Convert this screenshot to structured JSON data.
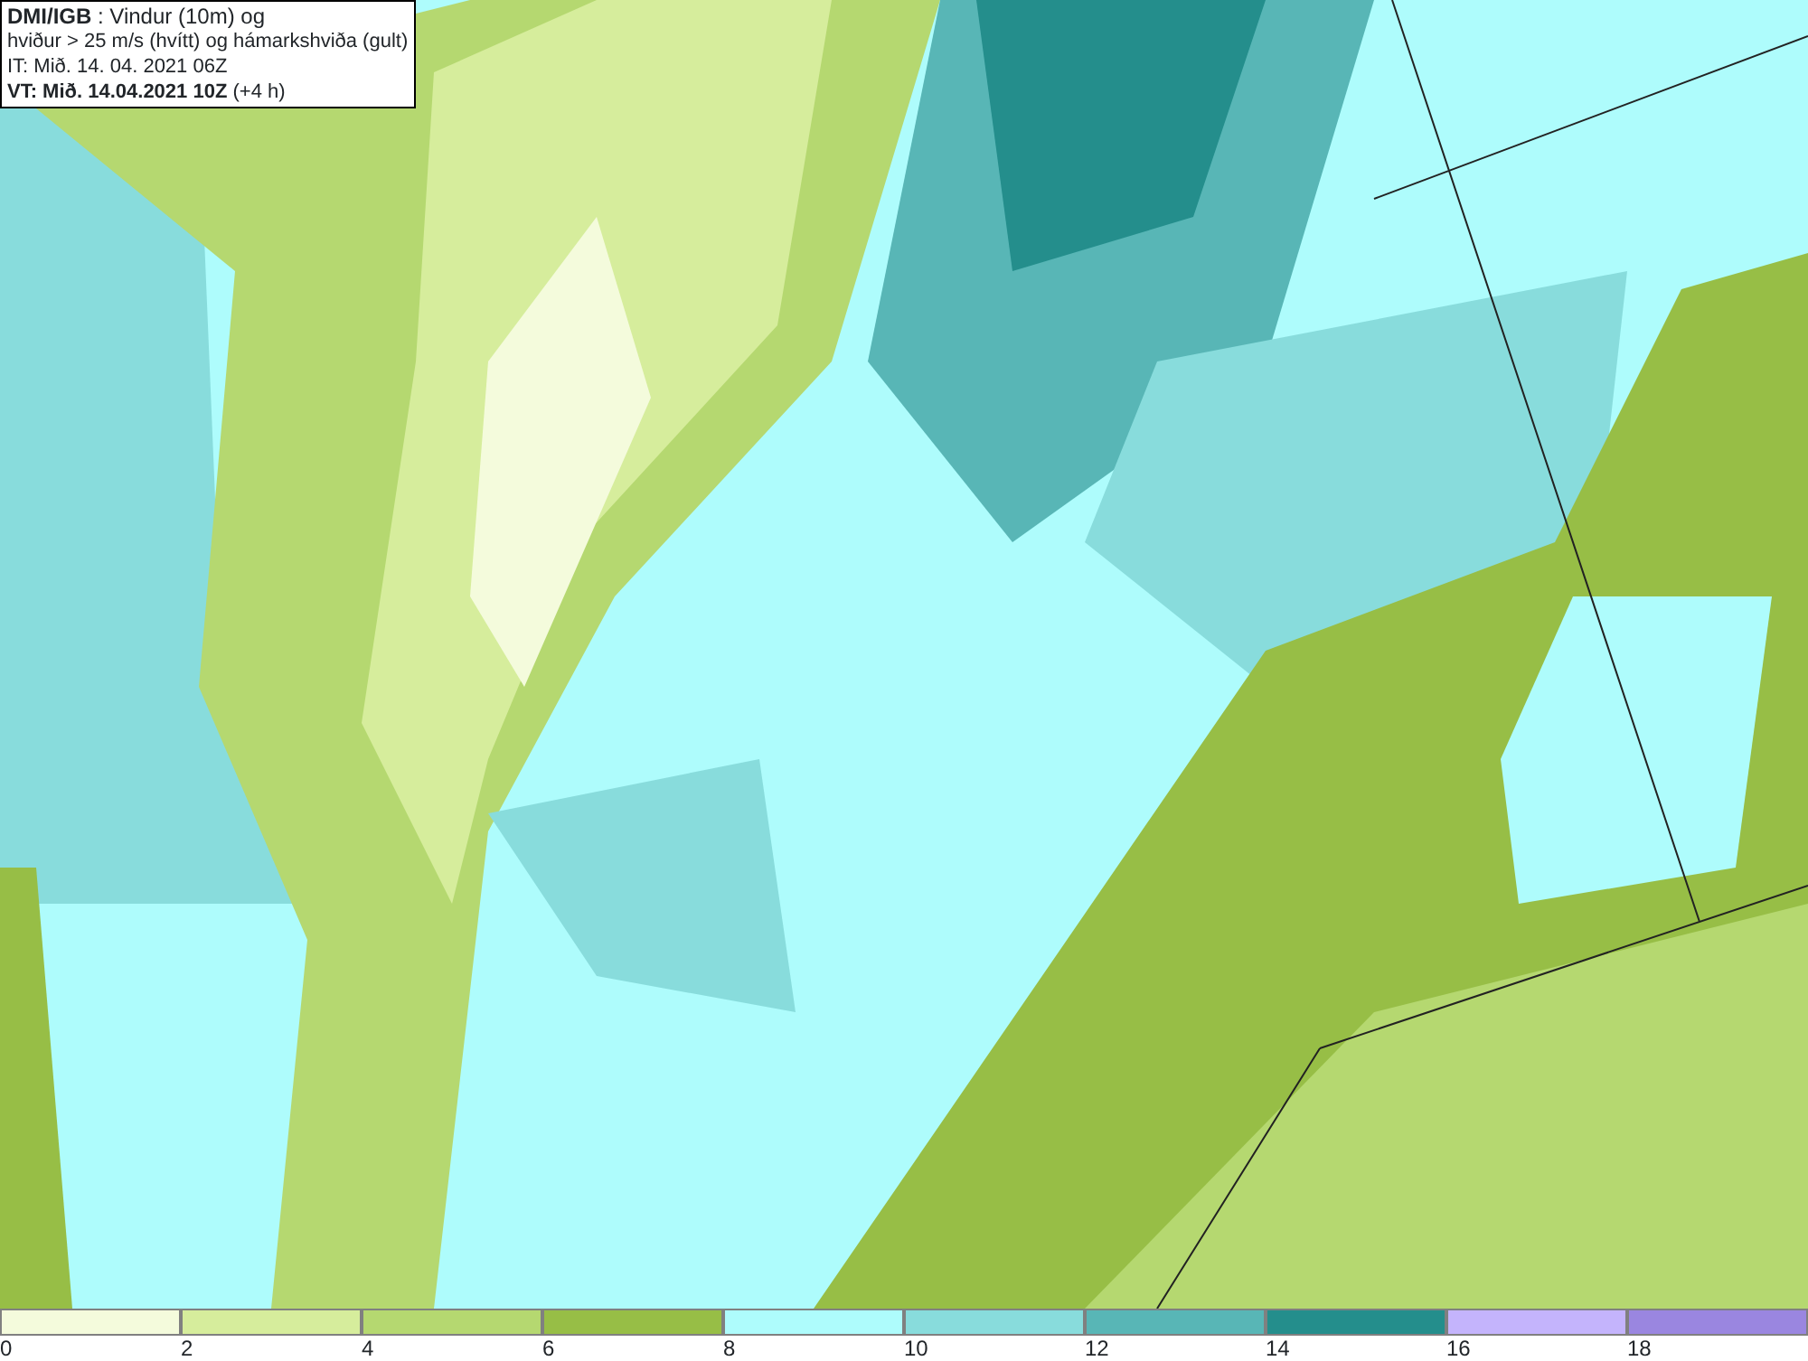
{
  "title_box": {
    "lines": [
      "**DMI/IGB** : Vindur (10m) og",
      "hviður > 25 m/s (hvítt) og hámarkshviða (gult)",
      "IT: Mið. 14. 04. 2021 06Z",
      "**VT: Mið. 14.04.2021 10Z** (+4 h)"
    ]
  },
  "legend": {
    "bins": [
      {
        "label": "0",
        "color": "#f4fbdc"
      },
      {
        "label": "2",
        "color": "#d6ed9c"
      },
      {
        "label": "4",
        "color": "#b5d870"
      },
      {
        "label": "6",
        "color": "#97be46"
      },
      {
        "label": "8",
        "color": "#aefcfc"
      },
      {
        "label": "10",
        "color": "#88dcdc"
      },
      {
        "label": "12",
        "color": "#58b6b6"
      },
      {
        "label": "14",
        "color": "#248e8c"
      },
      {
        "label": "16",
        "color": "#c4b4fc"
      },
      {
        "label": "18",
        "color": "#9a86e0"
      }
    ]
  }
}
